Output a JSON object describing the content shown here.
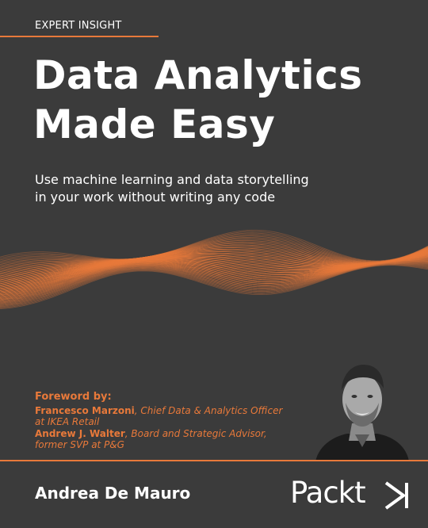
{
  "series_label": "EXPERT INSIGHT",
  "title_line1": "Data Analytics",
  "title_line2": "Made Easy",
  "subtitle_line1": "Use machine learning and data storytelling",
  "subtitle_line2": "in your work without writing any code",
  "foreword": {
    "heading": "Foreword by:",
    "person1_name": "Francesco Marzoni",
    "person1_role_line1": ", Chief Data & Analytics Officer",
    "person1_role_line2": "at IKEA Retail",
    "person2_name": "Andrew J. Walter",
    "person2_role_line1": ", Board and Strategic Advisor,",
    "person2_role_line2": "former SVP at P&G"
  },
  "author": "Andrea De Mauro",
  "publisher": "Packt",
  "colors": {
    "background": "#3b3b3b",
    "accent": "#e8793a",
    "text": "#ffffff"
  }
}
